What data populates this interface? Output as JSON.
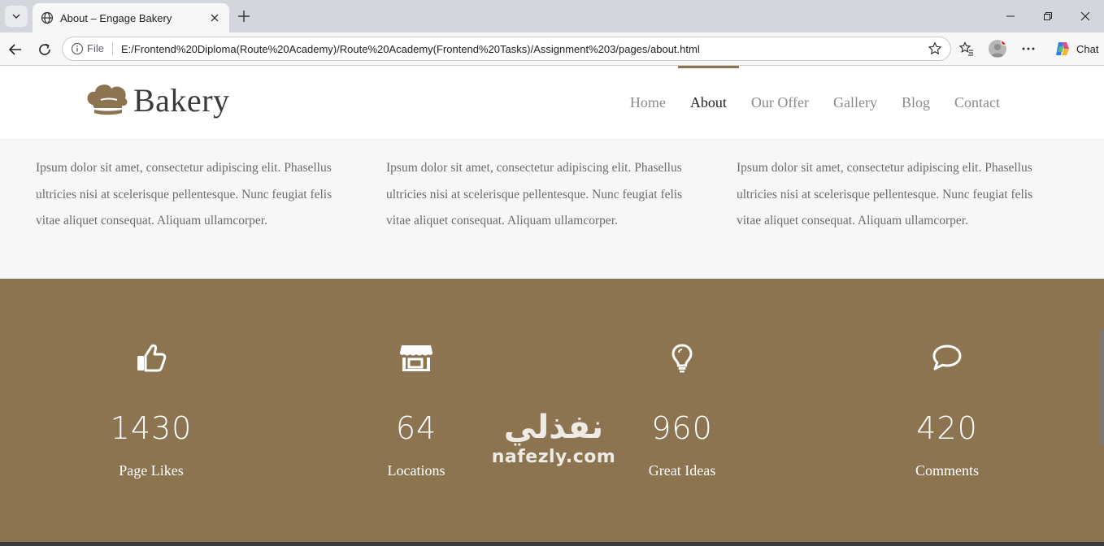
{
  "browser": {
    "tab_title": "About – Engage Bakery",
    "scheme_label": "File",
    "url": "E:/Frontend%20Diploma(Route%20Academy)/Route%20Academy(Frontend%20Tasks)/Assignment%203/pages/about.html",
    "chat_label": "Chat"
  },
  "site": {
    "brand": "Bakery",
    "nav": [
      {
        "label": "Home"
      },
      {
        "label": "About"
      },
      {
        "label": "Our Offer"
      },
      {
        "label": "Gallery"
      },
      {
        "label": "Blog"
      },
      {
        "label": "Contact"
      }
    ],
    "active_nav": "About",
    "accent_color": "#8c7451"
  },
  "features": [
    {
      "text": "Ipsum dolor sit amet, consectetur adipiscing elit. Phasellus ultricies nisi at scelerisque pellentesque. Nunc feugiat felis vitae aliquet consequat. Aliquam ullamcorper."
    },
    {
      "text": "Ipsum dolor sit amet, consectetur adipiscing elit. Phasellus ultricies nisi at scelerisque pellentesque. Nunc feugiat felis vitae aliquet consequat. Aliquam ullamcorper."
    },
    {
      "text": "Ipsum dolor sit amet, consectetur adipiscing elit. Phasellus ultricies nisi at scelerisque pellentesque. Nunc feugiat felis vitae aliquet consequat. Aliquam ullamcorper."
    }
  ],
  "stats": [
    {
      "icon": "thumbs-up-icon",
      "value": "1430",
      "label": "Page Likes"
    },
    {
      "icon": "store-icon",
      "value": "64",
      "label": "Locations"
    },
    {
      "icon": "lightbulb-icon",
      "value": "960",
      "label": "Great Ideas"
    },
    {
      "icon": "comment-icon",
      "value": "420",
      "label": "Comments"
    }
  ],
  "watermark": {
    "arabic": "نفذلي",
    "latin": "nafezly.com"
  }
}
